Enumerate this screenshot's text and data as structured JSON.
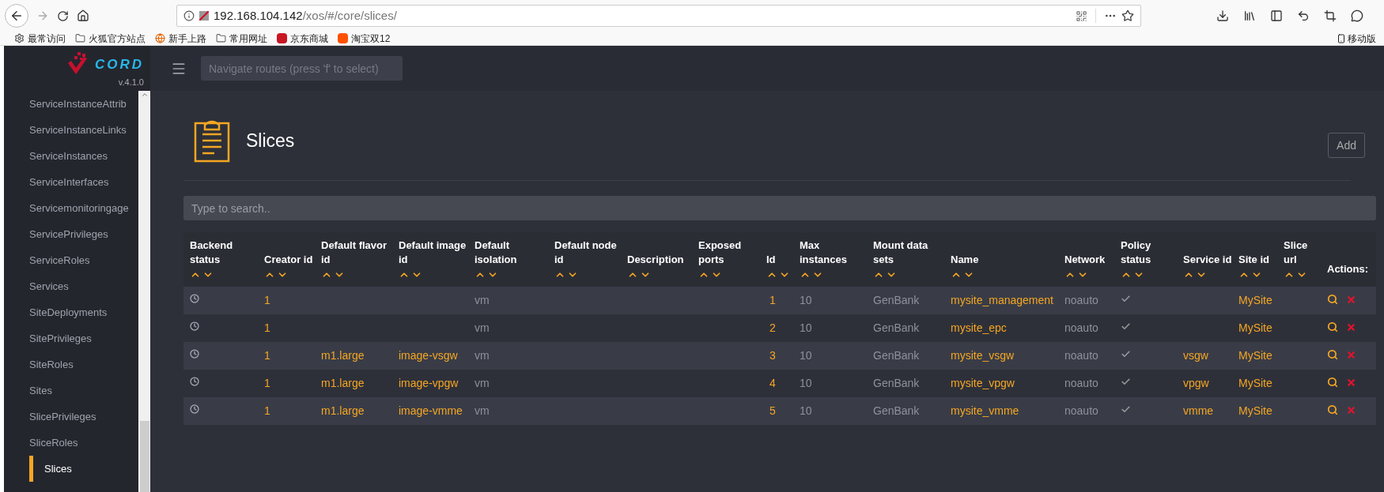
{
  "browser": {
    "url_host": "192.168.104.142",
    "url_path": "/xos/#/core/slices/",
    "bookmarks": [
      {
        "kind": "gear",
        "label": "最常访问"
      },
      {
        "kind": "folder",
        "label": "火狐官方站点"
      },
      {
        "kind": "globe",
        "label": "新手上路"
      },
      {
        "kind": "folder",
        "label": "常用网址"
      },
      {
        "kind": "jd",
        "label": "京东商城"
      },
      {
        "kind": "taobao",
        "label": "淘宝双12"
      }
    ],
    "mobile_label": "移动版"
  },
  "logo": {
    "wordmark": "CORD",
    "version": "v.4.1.0"
  },
  "sidebar": {
    "items": [
      {
        "label": "ServiceInstanceAttrib",
        "selected": false
      },
      {
        "label": "ServiceInstanceLinks",
        "selected": false
      },
      {
        "label": "ServiceInstances",
        "selected": false
      },
      {
        "label": "ServiceInterfaces",
        "selected": false
      },
      {
        "label": "Servicemonitoringage",
        "selected": false
      },
      {
        "label": "ServicePrivileges",
        "selected": false
      },
      {
        "label": "ServiceRoles",
        "selected": false
      },
      {
        "label": "Services",
        "selected": false
      },
      {
        "label": "SiteDeployments",
        "selected": false
      },
      {
        "label": "SitePrivileges",
        "selected": false
      },
      {
        "label": "SiteRoles",
        "selected": false
      },
      {
        "label": "Sites",
        "selected": false
      },
      {
        "label": "SlicePrivileges",
        "selected": false
      },
      {
        "label": "SliceRoles",
        "selected": false
      },
      {
        "label": "Slices",
        "selected": true
      }
    ]
  },
  "header": {
    "nav_placeholder": "Navigate routes (press 'f' to select)"
  },
  "page": {
    "title": "Slices",
    "add_button": "Add",
    "search_placeholder": "Type to search.."
  },
  "table": {
    "columns": [
      {
        "label": "Backend status",
        "kind": "status"
      },
      {
        "label": "Creator id",
        "kind": "link"
      },
      {
        "label": "Default flavor id",
        "kind": "link"
      },
      {
        "label": "Default image id",
        "kind": "link"
      },
      {
        "label": "Default isolation",
        "kind": "text"
      },
      {
        "label": "Default node id",
        "kind": "text"
      },
      {
        "label": "Description",
        "kind": "text"
      },
      {
        "label": "Exposed ports",
        "kind": "text"
      },
      {
        "label": "Id",
        "kind": "link"
      },
      {
        "label": "Max instances",
        "kind": "text"
      },
      {
        "label": "Mount data sets",
        "kind": "text"
      },
      {
        "label": "Name",
        "kind": "link"
      },
      {
        "label": "Network",
        "kind": "text"
      },
      {
        "label": "Policy status",
        "kind": "check"
      },
      {
        "label": "Service id",
        "kind": "link"
      },
      {
        "label": "Site id",
        "kind": "link"
      },
      {
        "label": "Slice url",
        "kind": "text"
      }
    ],
    "actions_label": "Actions:",
    "rows": [
      {
        "cells": [
          "",
          "1",
          "",
          "",
          "vm",
          "",
          "",
          "",
          "1",
          "10",
          "GenBank",
          "mysite_management",
          "noauto",
          "",
          "",
          "MySite",
          ""
        ]
      },
      {
        "cells": [
          "",
          "1",
          "",
          "",
          "vm",
          "",
          "",
          "",
          "2",
          "10",
          "GenBank",
          "mysite_epc",
          "noauto",
          "",
          "",
          "MySite",
          ""
        ]
      },
      {
        "cells": [
          "",
          "1",
          "m1.large",
          "image-vsgw",
          "vm",
          "",
          "",
          "",
          "3",
          "10",
          "GenBank",
          "mysite_vsgw",
          "noauto",
          "",
          "vsgw",
          "MySite",
          ""
        ]
      },
      {
        "cells": [
          "",
          "1",
          "m1.large",
          "image-vpgw",
          "vm",
          "",
          "",
          "",
          "4",
          "10",
          "GenBank",
          "mysite_vpgw",
          "noauto",
          "",
          "vpgw",
          "MySite",
          ""
        ]
      },
      {
        "cells": [
          "",
          "1",
          "m1.large",
          "image-vmme",
          "vm",
          "",
          "",
          "",
          "5",
          "10",
          "GenBank",
          "mysite_vmme",
          "noauto",
          "",
          "vmme",
          "MySite",
          ""
        ]
      }
    ]
  }
}
